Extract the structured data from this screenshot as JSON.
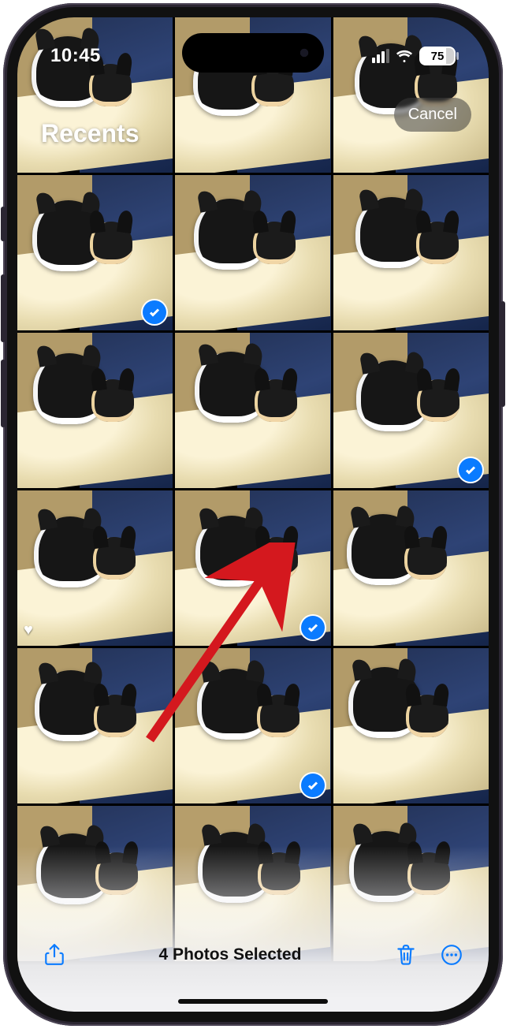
{
  "status": {
    "time": "10:45",
    "battery": "75"
  },
  "header": {
    "album_title": "Recents",
    "cancel_label": "Cancel"
  },
  "grid": {
    "rows": 6,
    "cols": 3,
    "items": [
      {
        "selected": false,
        "favorite": false
      },
      {
        "selected": false,
        "favorite": false
      },
      {
        "selected": false,
        "favorite": false
      },
      {
        "selected": true,
        "favorite": false
      },
      {
        "selected": false,
        "favorite": false
      },
      {
        "selected": false,
        "favorite": false
      },
      {
        "selected": false,
        "favorite": false
      },
      {
        "selected": false,
        "favorite": false
      },
      {
        "selected": true,
        "favorite": false
      },
      {
        "selected": false,
        "favorite": true
      },
      {
        "selected": true,
        "favorite": false
      },
      {
        "selected": false,
        "favorite": false
      },
      {
        "selected": false,
        "favorite": false
      },
      {
        "selected": true,
        "favorite": false
      },
      {
        "selected": false,
        "favorite": false
      },
      {
        "selected": false,
        "favorite": false
      },
      {
        "selected": false,
        "favorite": false
      },
      {
        "selected": false,
        "favorite": false
      }
    ]
  },
  "toolbar": {
    "selection_text": "4 Photos Selected"
  },
  "annotation": {
    "arrow_color": "#d4181e"
  }
}
